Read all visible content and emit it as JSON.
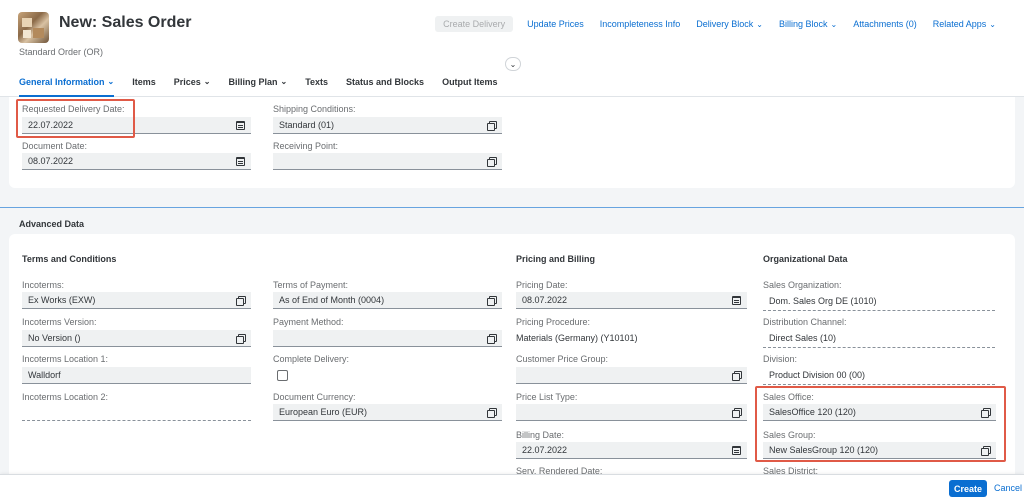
{
  "header": {
    "title": "New: Sales Order",
    "subtitle": "Standard Order (OR)",
    "actions": {
      "create_delivery": "Create Delivery",
      "update_prices": "Update Prices",
      "incompleteness_info": "Incompleteness Info",
      "delivery_block": "Delivery Block",
      "billing_block": "Billing Block",
      "attachments": "Attachments (0)",
      "related_apps": "Related Apps"
    }
  },
  "tabs": {
    "general_information": "General Information",
    "items": "Items",
    "prices": "Prices",
    "billing_plan": "Billing Plan",
    "texts": "Texts",
    "status_and_blocks": "Status and Blocks",
    "output_items": "Output Items"
  },
  "general": {
    "requested_delivery_date_label": "Requested Delivery Date:",
    "requested_delivery_date": "22.07.2022",
    "document_date_label": "Document Date:",
    "document_date": "08.07.2022",
    "shipping_conditions_label": "Shipping Conditions:",
    "shipping_conditions": "Standard (01)",
    "receiving_point_label": "Receiving Point:",
    "receiving_point": ""
  },
  "advanced": {
    "title": "Advanced Data",
    "terms": {
      "title": "Terms and Conditions",
      "incoterms_label": "Incoterms:",
      "incoterms": "Ex Works (EXW)",
      "incoterms_version_label": "Incoterms Version:",
      "incoterms_version": "No Version ()",
      "incoterms_location1_label": "Incoterms Location 1:",
      "incoterms_location1": "Walldorf",
      "incoterms_location2_label": "Incoterms Location 2:",
      "incoterms_location2": "",
      "terms_of_payment_label": "Terms of Payment:",
      "terms_of_payment": "As of End of Month (0004)",
      "payment_method_label": "Payment Method:",
      "payment_method": "",
      "complete_delivery_label": "Complete Delivery:",
      "document_currency_label": "Document Currency:",
      "document_currency": "European Euro (EUR)"
    },
    "pricing": {
      "title": "Pricing and Billing",
      "pricing_date_label": "Pricing Date:",
      "pricing_date": "08.07.2022",
      "pricing_procedure_label": "Pricing Procedure:",
      "pricing_procedure": "Materials (Germany) (Y10101)",
      "customer_price_group_label": "Customer Price Group:",
      "customer_price_group": "",
      "price_list_type_label": "Price List Type:",
      "price_list_type": "",
      "billing_date_label": "Billing Date:",
      "billing_date": "22.07.2022",
      "serv_rendered_date_label": "Serv. Rendered Date:"
    },
    "org": {
      "title": "Organizational Data",
      "sales_org_label": "Sales Organization:",
      "sales_org": "Dom. Sales Org DE (1010)",
      "dist_channel_label": "Distribution Channel:",
      "dist_channel": "Direct Sales (10)",
      "division_label": "Division:",
      "division": "Product Division 00 (00)",
      "sales_office_label": "Sales Office:",
      "sales_office": "SalesOffice 120 (120)",
      "sales_group_label": "Sales Group:",
      "sales_group": "New SalesGroup 120 (120)",
      "sales_district_label": "Sales District:"
    }
  },
  "footer": {
    "create": "Create",
    "cancel": "Cancel"
  },
  "colors": {
    "brand_blue": "#0a6ed1",
    "highlight_red": "#e05a47"
  }
}
